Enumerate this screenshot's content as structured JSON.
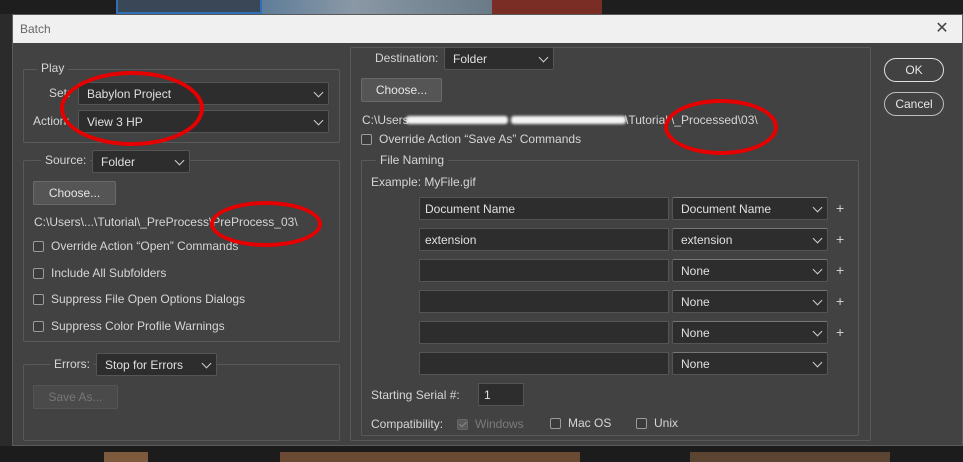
{
  "dialog": {
    "title": "Batch"
  },
  "play": {
    "legend": "Play",
    "set_label": "Set:",
    "set_value": "Babylon Project",
    "action_label": "Action:",
    "action_value": "View 3 HP"
  },
  "source": {
    "label": "Source:",
    "value": "Folder",
    "choose_label": "Choose...",
    "path": "C:\\Users\\...\\Tutorial\\_PreProcess\\PreProcess_03\\",
    "options": [
      {
        "label": "Override Action “Open” Commands",
        "checked": false
      },
      {
        "label": "Include All Subfolders",
        "checked": false
      },
      {
        "label": "Suppress File Open Options Dialogs",
        "checked": false
      },
      {
        "label": "Suppress Color Profile Warnings",
        "checked": false
      }
    ]
  },
  "errors": {
    "label": "Errors:",
    "value": "Stop for Errors",
    "save_as_label": "Save As..."
  },
  "destination": {
    "label": "Destination:",
    "value": "Folder",
    "choose_label": "Choose...",
    "path_start": "C:\\Users",
    "path_mid": "\\Tutorial",
    "path_end": "\\_Processed\\03\\",
    "override_label": "Override Action “Save As” Commands"
  },
  "file_naming": {
    "legend": "File Naming",
    "example": "Example: MyFile.gif",
    "rows": [
      {
        "text": "Document Name",
        "select": "Document Name"
      },
      {
        "text": "extension",
        "select": "extension"
      },
      {
        "text": "",
        "select": "None"
      },
      {
        "text": "",
        "select": "None"
      },
      {
        "text": "",
        "select": "None"
      },
      {
        "text": "",
        "select": "None"
      }
    ],
    "plus_symbol": "+",
    "serial_label": "Starting Serial #:",
    "serial_value": "1",
    "compat_label": "Compatibility:",
    "compat": [
      {
        "label": "Windows",
        "checked": true,
        "disabled": true
      },
      {
        "label": "Mac OS",
        "checked": false,
        "disabled": false
      },
      {
        "label": "Unix",
        "checked": false,
        "disabled": false
      }
    ]
  },
  "actions": {
    "ok_label": "OK",
    "cancel_label": "Cancel"
  },
  "colors": {
    "annotation": "#e60000",
    "panel": "#424242",
    "field": "#2d2d2d"
  }
}
